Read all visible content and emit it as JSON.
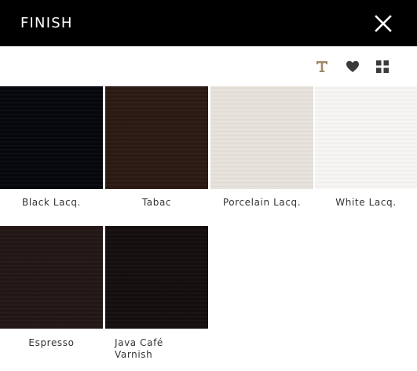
{
  "header": {
    "title": "FINISH"
  },
  "icons": {
    "close": "close-icon",
    "text": "text-icon",
    "favorite": "heart-icon",
    "grid": "grid-icon"
  },
  "colors": {
    "header_bg": "#000000",
    "text_icon": "#a08a6a",
    "toolbar_icon": "#3a3a3a"
  },
  "swatches": [
    {
      "label": "Black Lacq.",
      "color": "#05070b"
    },
    {
      "label": "Tabac",
      "color": "#2b1a13"
    },
    {
      "label": "Porcelain Lacq.",
      "color": "#e8e4dd"
    },
    {
      "label": "White Lacq.",
      "color": "#f8f7f5"
    },
    {
      "label": "Espresso",
      "color": "#231716"
    },
    {
      "label": "Java Café Varnish",
      "color": "#140e0e"
    }
  ]
}
